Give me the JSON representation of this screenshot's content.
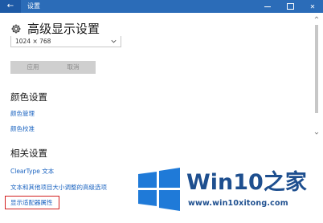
{
  "window": {
    "title": "设置",
    "back_glyph": "←",
    "close_glyph": "✕"
  },
  "header": {
    "title": "高级显示设置",
    "icon": "gear-icon"
  },
  "resolution": {
    "value": "1024 × 768",
    "icon": "chevron-down-icon"
  },
  "buttons": {
    "apply": "应用",
    "cancel": "取消"
  },
  "color_section": {
    "title": "颜色设置",
    "links": [
      "颜色管理",
      "颜色校准"
    ]
  },
  "related_section": {
    "title": "相关设置",
    "links": [
      "ClearType 文本",
      "文本和其他项目大小调整的高级选项",
      "显示适配器属性"
    ]
  },
  "colors": {
    "titlebar": "#2b6cb8",
    "link": "#1a63c0",
    "highlight": "#d32020",
    "watermark_blue": "#1e4f8f"
  },
  "watermark": {
    "brand": "Win10之家",
    "domain": "www.win10xitong.com"
  }
}
